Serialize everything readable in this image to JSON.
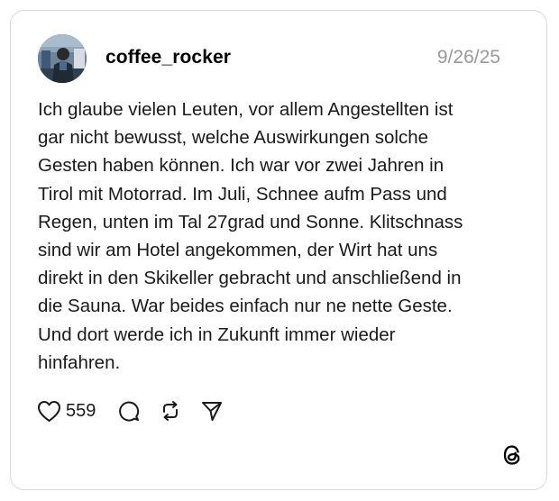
{
  "post": {
    "username": "coffee_rocker",
    "date": "9/26/25",
    "text": "Ich glaube vielen Leuten, vor allem Angestellten ist\ngar nicht bewusst, welche Auswirkungen solche\nGesten haben können. Ich war vor zwei Jahren in\nTirol mit Motorrad. Im Juli, Schnee aufm Pass und\nRegen, unten im Tal 27grad und Sonne. Klitschnass\nsind wir am Hotel angekommen, der Wirt hat uns\ndirekt in den Skikeller gebracht und anschließend in\ndie Sauna. War beides einfach nur ne nette Geste.\nUnd dort werde ich in Zukunft immer wieder\nhinfahren."
  },
  "actions": {
    "like_count": "559",
    "icons": [
      "heart-icon",
      "comment-icon",
      "repost-icon",
      "share-icon"
    ]
  },
  "brand": {
    "logo": "threads-logo-icon"
  },
  "colors": {
    "border": "#d9d9d9",
    "muted_text": "#999999",
    "text": "#1a1a1a"
  }
}
